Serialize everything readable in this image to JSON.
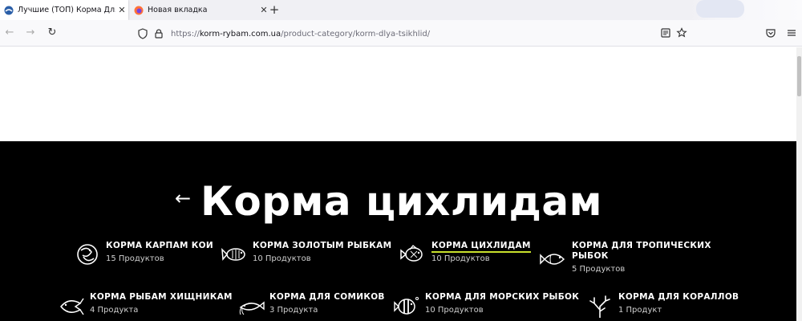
{
  "browser": {
    "tabs": [
      {
        "title": "Лучшие (ТОП) Корма Для Цихлид",
        "active": true
      },
      {
        "title": "Новая вкладка",
        "active": false
      }
    ],
    "url": {
      "protocol": "https://",
      "host": "korm-rybam.com.ua",
      "path": "/product-category/korm-dlya-tsikhlid/"
    }
  },
  "page": {
    "back_arrow": "←",
    "title": "Корма цихлидам",
    "categories": [
      {
        "name": "КОРМА КАРПАМ КОИ",
        "count": "15 Продуктов",
        "icon": "koi-icon",
        "active": false
      },
      {
        "name": "КОРМА ЗОЛОТЫМ РЫБКАМ",
        "count": "10 Продуктов",
        "icon": "goldfish-icon",
        "active": false
      },
      {
        "name": "КОРМА ЦИХЛИДАМ",
        "count": "10 Продуктов",
        "icon": "cichlid-icon",
        "active": true
      },
      {
        "name1": "КОРМА ДЛЯ ТРОПИЧЕСКИХ",
        "name2": "РЫБОК",
        "count": "5 Продуктов",
        "icon": "tropical-fish-icon",
        "active": false
      },
      {
        "name": "КОРМА РЫБАМ ХИЩНИКАМ",
        "count": "4 Продукта",
        "icon": "predator-fish-icon",
        "active": false
      },
      {
        "name": "КОРМА ДЛЯ СОМИКОВ",
        "count": "3 Продукта",
        "icon": "catfish-icon",
        "active": false
      },
      {
        "name": "КОРМА ДЛЯ МОРСКИХ РЫБОК",
        "count": "10 Продуктов",
        "icon": "marine-fish-icon",
        "active": false
      },
      {
        "name": "КОРМА ДЛЯ КОРАЛЛОВ",
        "count": "1 Продукт",
        "icon": "coral-icon",
        "active": false
      }
    ]
  },
  "colors": {
    "accent": "#c8e02c",
    "hero_bg": "#000000"
  }
}
